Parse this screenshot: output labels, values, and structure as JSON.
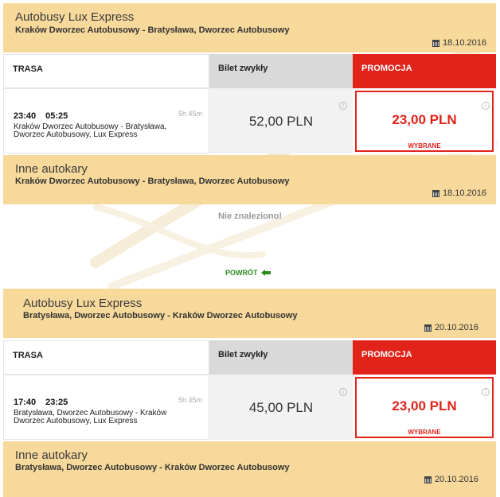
{
  "outbound": {
    "operator": "Autobusy Lux Express",
    "route": "Kraków Dworzec Autobusowy - Bratysława, Dworzec Autobusowy",
    "date": "18.10.2016",
    "table": {
      "col_route": "TRASA",
      "col_regular": "Bilet zwykły",
      "col_promo": "PROMOCJA",
      "departure": "23:40",
      "arrival": "05:25",
      "duration": "5h 45m",
      "stations": "Kraków Dworzec Autobusowy - Bratysława, Dworzec Autobusowy, Lux Express",
      "regular_price": "52,00 PLN",
      "promo_price": "23,00 PLN",
      "selected_label": "WYBRANE"
    },
    "other": {
      "title": "Inne autokary",
      "route": "Kraków Dworzec Autobusowy - Bratysława, Dworzec Autobusowy",
      "date": "18.10.2016",
      "empty_message": "Nie znaleziono!"
    }
  },
  "back_label": "POWRÓT",
  "return": {
    "operator": "Autobusy Lux Express",
    "route": "Bratysława, Dworzec Autobusowy - Kraków Dworzec Autobusowy",
    "date": "20.10.2016",
    "table": {
      "col_route": "TRASA",
      "col_regular": "Bilet zwykły",
      "col_promo": "PROMOCJA",
      "departure": "17:40",
      "arrival": "23:25",
      "duration": "5h 45m",
      "stations": "Bratysława, Dworzec Autobusowy - Kraków Dworzec Autobusowy, Lux Express",
      "regular_price": "45,00 PLN",
      "promo_price": "23,00 PLN",
      "selected_label": "WYBRANE"
    },
    "other": {
      "title": "Inne autokary",
      "route": "Bratysława, Dworzec Autobusowy - Kraków Dworzec Autobusowy",
      "date": "20.10.2016"
    }
  },
  "colors": {
    "panel_bg": "#f7d99b",
    "promo_red": "#e2231a",
    "back_green": "#2c8a1c"
  }
}
